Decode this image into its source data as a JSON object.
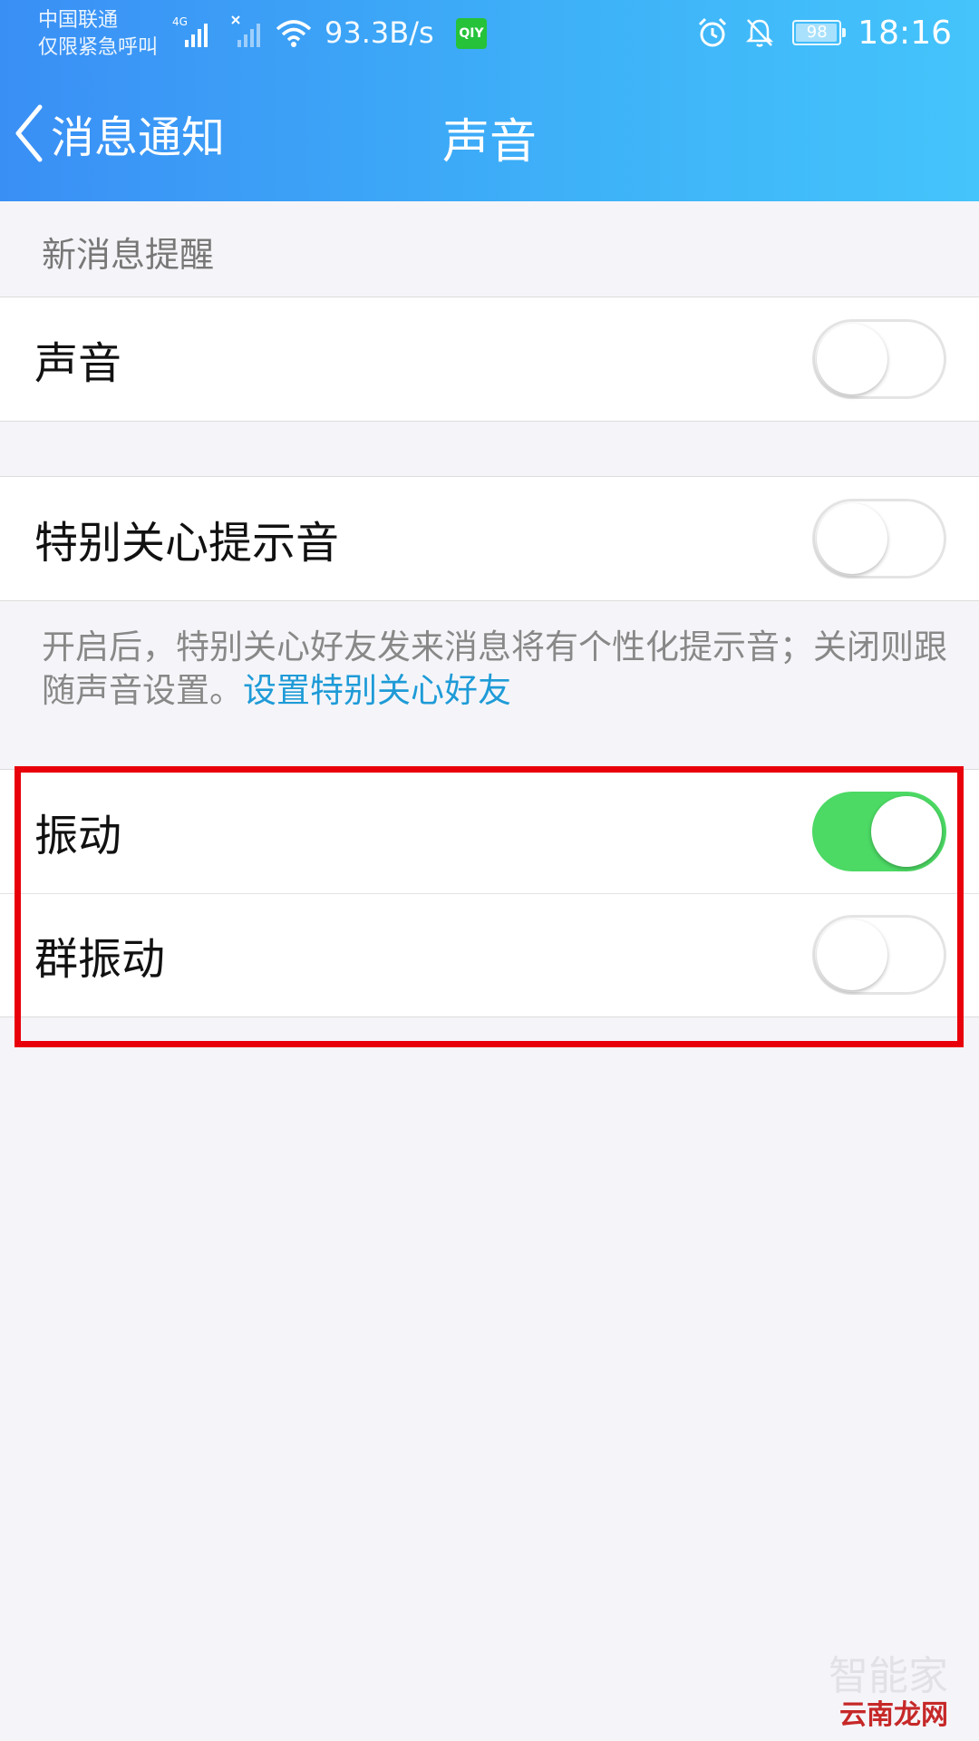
{
  "status_bar": {
    "carrier_line1": "中国联通",
    "carrier_line2": "仅限紧急呼叫",
    "network_type": "4G",
    "net_speed": "93.3B/s",
    "app_badge": "QIY",
    "battery_level": "98",
    "time": "18:16",
    "icons": [
      "signal-icon",
      "no-signal-icon",
      "wifi-icon",
      "iqiyi-icon",
      "alarm-icon",
      "bell-off-icon",
      "battery-icon"
    ]
  },
  "nav": {
    "back_label": "消息通知",
    "title": "声音"
  },
  "section_header": "新消息提醒",
  "settings": {
    "sound": {
      "label": "声音",
      "enabled": false
    },
    "special_care_tone": {
      "label": "特别关心提示音",
      "enabled": false
    },
    "vibrate": {
      "label": "振动",
      "enabled": true
    },
    "group_vibrate": {
      "label": "群振动",
      "enabled": false
    }
  },
  "description": {
    "text": "开启后，特别关心好友发来消息将有个性化提示音；关闭则跟随声音设置。",
    "link": "设置特别关心好友"
  },
  "watermark": {
    "top": "智能家",
    "bottom": "云南龙网"
  },
  "colors": {
    "header_start": "#3a8ff5",
    "header_end": "#44c4fb",
    "toggle_on": "#4cd964",
    "link": "#1e9bd7",
    "highlight_box": "#e8000b"
  }
}
